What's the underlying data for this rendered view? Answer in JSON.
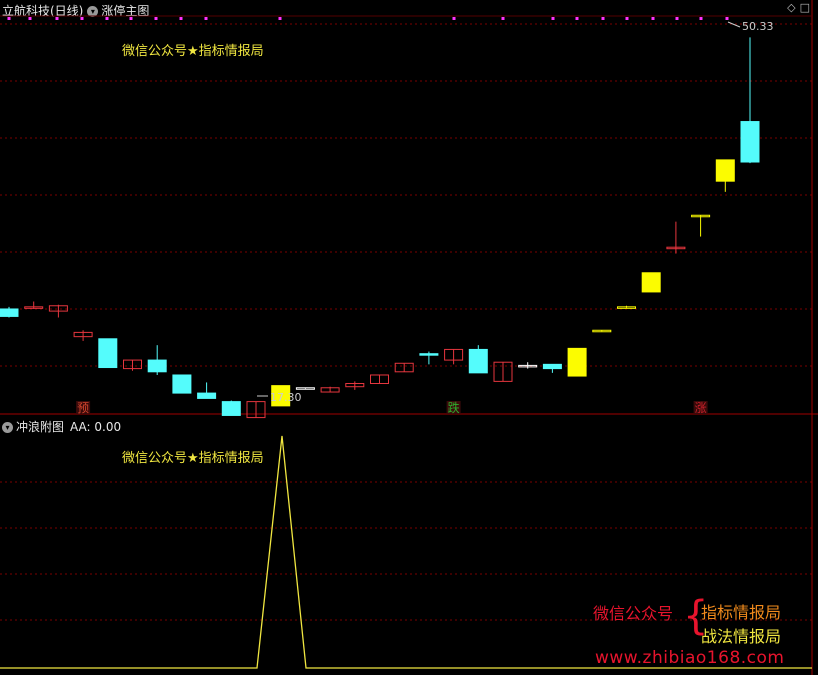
{
  "header": {
    "stock_name": "立航科技(日线)",
    "indicator_name": "涨停主图",
    "icons": [
      "diamond-icon",
      "close-icon"
    ]
  },
  "sub_panel": {
    "indicator_name": "冲浪附图",
    "aa_label": "AA: 0.00"
  },
  "watermark": {
    "main": "微信公众号★指标情报局",
    "sub": "微信公众号★指标情报局"
  },
  "signals": [
    {
      "text": "预",
      "color": "#d2452d",
      "index": 3
    },
    {
      "text": "跌",
      "color": "#2db02d",
      "index": 18
    },
    {
      "text": "涨",
      "color": "#c8202a",
      "index": 28
    }
  ],
  "price_labels": {
    "high": "50.33",
    "low": "17.30"
  },
  "brand": {
    "wechat": "微信公众号",
    "line1": "指标情报局",
    "line2": "战法情报局",
    "url": "www.zhibiao168.com"
  },
  "colors": {
    "up": "#e6363e",
    "down": "#54fcfc",
    "limit_up": "#fcfc00",
    "grid": "#7a0000",
    "dots": "#ff33ff"
  },
  "chart_data": {
    "type": "candlestick",
    "price_range": [
      15.5,
      52.5
    ],
    "candles": [
      {
        "o": 24.8,
        "h": 25.0,
        "l": 24.0,
        "c": 24.1
      },
      {
        "o": 24.9,
        "h": 25.5,
        "l": 24.8,
        "c": 25.0
      },
      {
        "o": 24.6,
        "h": 25.2,
        "l": 24.0,
        "c": 25.1
      },
      {
        "o": 22.2,
        "h": 22.8,
        "l": 21.8,
        "c": 22.6
      },
      {
        "o": 22.0,
        "h": 22.0,
        "l": 19.3,
        "c": 19.3
      },
      {
        "o": 19.2,
        "h": 20.0,
        "l": 19.0,
        "c": 20.0
      },
      {
        "o": 20.0,
        "h": 21.4,
        "l": 18.6,
        "c": 18.9
      },
      {
        "o": 18.6,
        "h": 18.6,
        "l": 16.9,
        "c": 16.9
      },
      {
        "o": 16.9,
        "h": 17.9,
        "l": 16.4,
        "c": 16.4
      },
      {
        "o": 16.1,
        "h": 16.2,
        "l": 14.8,
        "c": 14.8
      },
      {
        "o": 14.6,
        "h": 16.1,
        "l": 14.6,
        "c": 16.1
      },
      {
        "o": 15.7,
        "h": 17.6,
        "l": 15.7,
        "c": 17.6
      },
      {
        "o": 17.4,
        "h": 17.4,
        "l": 17.3,
        "c": 17.4
      },
      {
        "o": 17.0,
        "h": 17.5,
        "l": 17.0,
        "c": 17.4
      },
      {
        "o": 17.5,
        "h": 18.0,
        "l": 17.2,
        "c": 17.8
      },
      {
        "o": 17.8,
        "h": 18.6,
        "l": 17.8,
        "c": 18.6
      },
      {
        "o": 18.9,
        "h": 19.7,
        "l": 18.9,
        "c": 19.7
      },
      {
        "o": 20.6,
        "h": 20.8,
        "l": 19.6,
        "c": 20.5
      },
      {
        "o": 20.0,
        "h": 21.0,
        "l": 19.6,
        "c": 21.0
      },
      {
        "o": 21.0,
        "h": 21.4,
        "l": 18.8,
        "c": 18.8
      },
      {
        "o": 18.0,
        "h": 19.8,
        "l": 18.0,
        "c": 19.8
      },
      {
        "o": 19.5,
        "h": 19.8,
        "l": 19.2,
        "c": 19.5
      },
      {
        "o": 19.6,
        "h": 19.6,
        "l": 18.8,
        "c": 19.2
      },
      {
        "o": 18.5,
        "h": 21.1,
        "l": 18.5,
        "c": 21.1
      },
      {
        "o": 22.8,
        "h": 22.8,
        "l": 22.7,
        "c": 22.8
      },
      {
        "o": 25.0,
        "h": 25.1,
        "l": 24.9,
        "c": 25.0
      },
      {
        "o": 26.4,
        "h": 27.4,
        "l": 26.4,
        "c": 28.2
      },
      {
        "o": 30.6,
        "h": 33.0,
        "l": 30.0,
        "c": 30.6
      },
      {
        "o": 33.6,
        "h": 33.6,
        "l": 31.6,
        "c": 33.6
      },
      {
        "o": 36.8,
        "h": 38.8,
        "l": 35.8,
        "c": 38.8
      },
      {
        "o": 42.4,
        "h": 50.3,
        "l": 38.5,
        "c": 38.6
      }
    ],
    "sub_series": {
      "name": "AA",
      "values": [
        0,
        0,
        0,
        0,
        0,
        0,
        0,
        0,
        0,
        0,
        0,
        1,
        0,
        0,
        0,
        0,
        0,
        0,
        0,
        0,
        0,
        0,
        0,
        0,
        0,
        0,
        0,
        0,
        0,
        0,
        0,
        0
      ]
    }
  }
}
